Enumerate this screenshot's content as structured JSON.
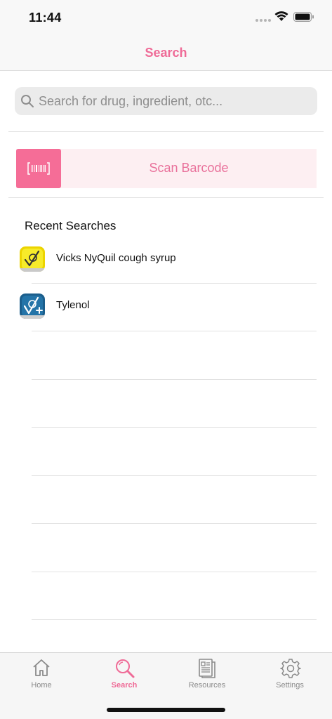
{
  "status_bar": {
    "time": "11:44"
  },
  "nav": {
    "title": "Search"
  },
  "search": {
    "placeholder": "Search for drug, ingredient, otc..."
  },
  "scan": {
    "label": "Scan Barcode"
  },
  "recent": {
    "title": "Recent Searches",
    "items": [
      {
        "label": "Vicks NyQuil cough syrup",
        "icon": "yellow-check-badge-icon"
      },
      {
        "label": "Tylenol",
        "icon": "blue-check-plus-badge-icon"
      }
    ]
  },
  "tabs": [
    {
      "label": "Home",
      "icon": "home-icon"
    },
    {
      "label": "Search",
      "icon": "magnifier-icon"
    },
    {
      "label": "Resources",
      "icon": "document-icon"
    },
    {
      "label": "Settings",
      "icon": "gear-icon"
    }
  ],
  "colors": {
    "accent": "#ef6b97",
    "scan_icon_bg": "#f56d97",
    "scan_row_bg": "#fdeff2",
    "search_bg": "#ebebeb",
    "tab_inactive": "#8a8a8a"
  }
}
